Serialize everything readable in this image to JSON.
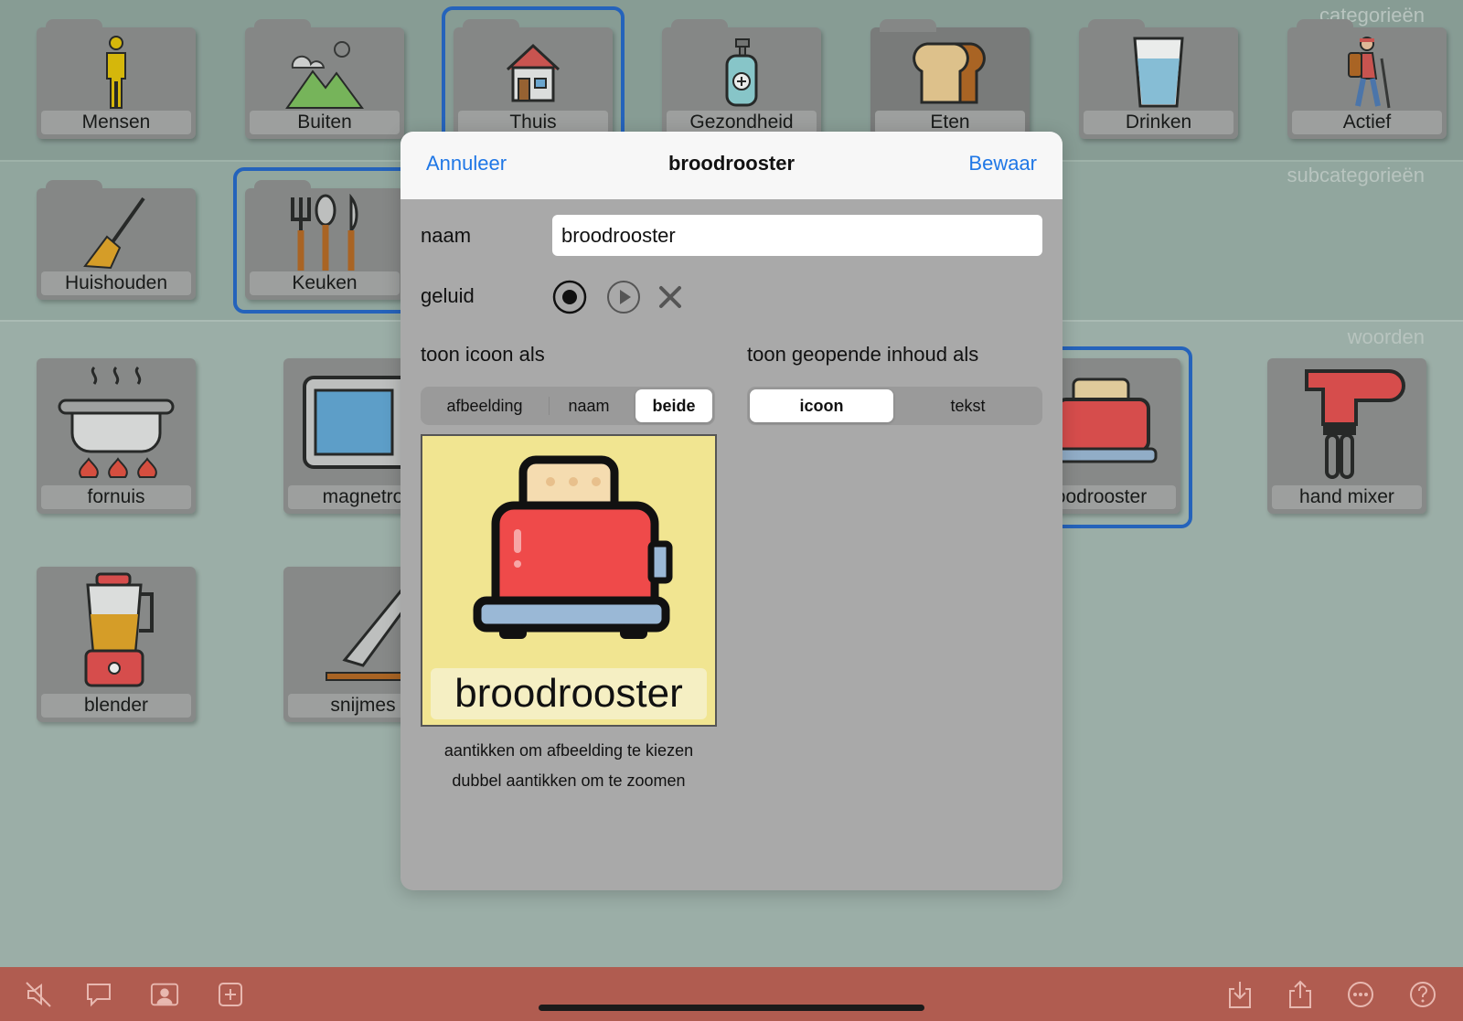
{
  "sections": {
    "categories": "categorieën",
    "subcategories": "subcategorieën",
    "words": "woorden"
  },
  "categories": [
    {
      "label": "Mensen",
      "icon": "person-icon"
    },
    {
      "label": "Buiten",
      "icon": "mountains-icon"
    },
    {
      "label": "Thuis",
      "icon": "house-icon"
    },
    {
      "label": "Gezondheid",
      "icon": "sanitizer-icon"
    },
    {
      "label": "Eten",
      "icon": "bread-icon"
    },
    {
      "label": "Drinken",
      "icon": "glass-icon"
    },
    {
      "label": "Actief",
      "icon": "hiker-icon"
    }
  ],
  "subcategories": [
    {
      "label": "Huishouden",
      "icon": "broom-icon"
    },
    {
      "label": "Keuken",
      "icon": "cutlery-icon"
    }
  ],
  "words": [
    {
      "label": "fornuis",
      "icon": "stove-icon"
    },
    {
      "label": "magnetro",
      "icon": "microwave-icon"
    },
    {
      "label": "oodrooster",
      "icon": "toaster-icon"
    },
    {
      "label": "hand mixer",
      "icon": "mixer-icon"
    },
    {
      "label": "blender",
      "icon": "blender-icon"
    },
    {
      "label": "snijmes",
      "icon": "knife-icon"
    }
  ],
  "dialog": {
    "cancel": "Annuleer",
    "title": "broodrooster",
    "save": "Bewaar",
    "name_label": "naam",
    "name_value": "broodrooster",
    "sound_label": "geluid",
    "show_icon_label": "toon icoon als",
    "show_icon_options": [
      "afbeelding",
      "naam",
      "beide"
    ],
    "show_icon_selected": "beide",
    "show_content_label": "toon geopende inhoud als",
    "show_content_options": [
      "icoon",
      "tekst"
    ],
    "show_content_selected": "icoon",
    "preview_label": "broodrooster",
    "hint1": "aantikken om afbeelding te kiezen",
    "hint2": "dubbel aantikken om te zoomen"
  },
  "toolbar": {
    "left": [
      "mute-icon",
      "speech-bubble-icon",
      "person-card-icon",
      "add-square-icon"
    ],
    "right": [
      "download-icon",
      "share-icon",
      "more-icon",
      "help-icon"
    ]
  },
  "colors": {
    "accent": "#1f77e6",
    "selection": "#1f63c9",
    "toolbar": "#b05c50",
    "preview_bg": "#f1e591"
  }
}
